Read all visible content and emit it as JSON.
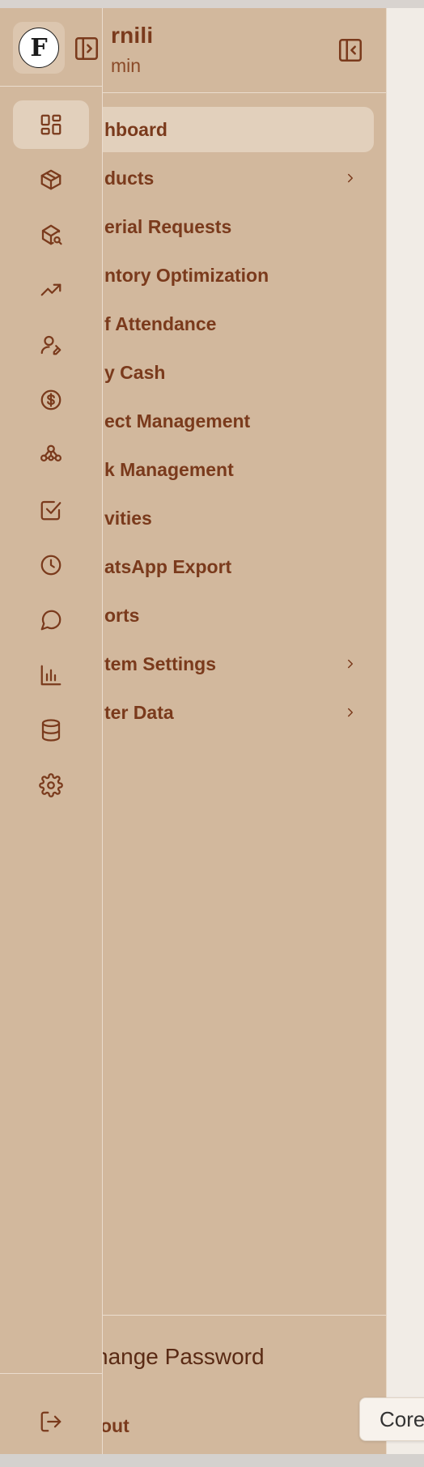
{
  "brand": {
    "name": "rnili",
    "role": "min"
  },
  "menu": [
    {
      "label": "hboard",
      "active": true,
      "has_children": false
    },
    {
      "label": "ducts",
      "active": false,
      "has_children": true
    },
    {
      "label": "erial Requests",
      "active": false,
      "has_children": false
    },
    {
      "label": "ntory Optimization",
      "active": false,
      "has_children": false
    },
    {
      "label": "f Attendance",
      "active": false,
      "has_children": false
    },
    {
      "label": "y Cash",
      "active": false,
      "has_children": false
    },
    {
      "label": "ect Management",
      "active": false,
      "has_children": false
    },
    {
      "label": "k Management",
      "active": false,
      "has_children": false
    },
    {
      "label": "vities",
      "active": false,
      "has_children": false
    },
    {
      "label": "atsApp Export",
      "active": false,
      "has_children": false
    },
    {
      "label": "orts",
      "active": false,
      "has_children": false
    },
    {
      "label": "tem Settings",
      "active": false,
      "has_children": true
    },
    {
      "label": "ter Data",
      "active": false,
      "has_children": true
    }
  ],
  "footer": {
    "change_password": "hange Password",
    "logout": "out"
  },
  "rail_icons": [
    "dashboard-icon",
    "box-icon",
    "box-search-icon",
    "trending-up-icon",
    "user-edit-icon",
    "dollar-circle-icon",
    "network-icon",
    "checkbox-icon",
    "clock-icon",
    "message-icon",
    "bar-chart-icon",
    "database-icon",
    "gear-icon"
  ],
  "rail_logout_icon": "logout-icon",
  "logo_letter": "F",
  "chip": {
    "label": "Core"
  },
  "colors": {
    "sidebar_bg": "#d2b89d",
    "accent": "#7a3a1c",
    "active_bg": "#e2d0bc",
    "content_bg": "#f1ece6"
  }
}
